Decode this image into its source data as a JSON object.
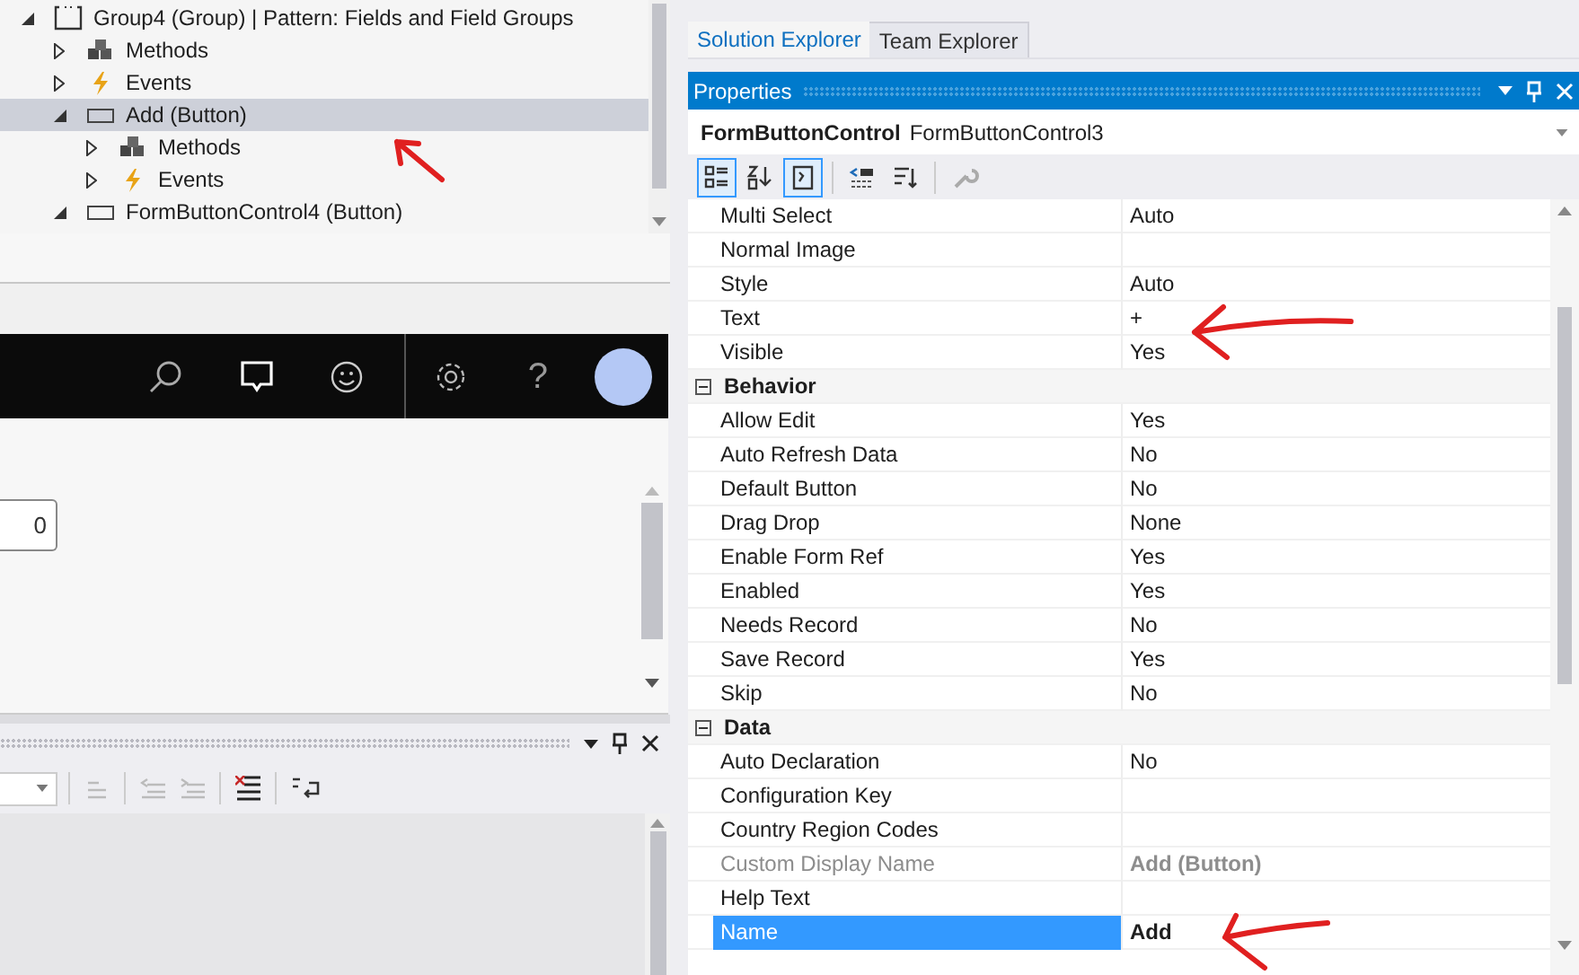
{
  "tree": [
    {
      "label": "Group4 (Group) | Pattern: Fields and Field Groups",
      "kind": "group",
      "expanded": true,
      "selected": false,
      "children": [
        {
          "label": "Methods",
          "kind": "methods",
          "expanded": false,
          "selected": false
        },
        {
          "label": "Events",
          "kind": "events",
          "expanded": false,
          "selected": false
        },
        {
          "label": "Add (Button)",
          "kind": "button",
          "expanded": true,
          "selected": true,
          "children": [
            {
              "label": "Methods",
              "kind": "methods",
              "expanded": false,
              "selected": false
            },
            {
              "label": "Events",
              "kind": "events",
              "expanded": false,
              "selected": false
            }
          ]
        },
        {
          "label": "FormButtonControl4 (Button)",
          "kind": "button",
          "expanded": true,
          "selected": false
        }
      ]
    }
  ],
  "help_button": {
    "label": "?"
  },
  "form_field": {
    "value": "0"
  },
  "tabs": [
    {
      "label": "Solution Explorer",
      "selected": true
    },
    {
      "label": "Team Explorer",
      "selected": false
    }
  ],
  "properties": {
    "title": "Properties",
    "object_type": "FormButtonControl",
    "object_name": "FormButtonControl3",
    "toolbar": [
      {
        "kind": "categorized",
        "selected": true
      },
      {
        "kind": "alphabetical",
        "selected": false
      },
      {
        "kind": "properties",
        "selected": true
      },
      {
        "kind": "events",
        "selected": false
      },
      {
        "kind": "sort",
        "selected": false
      },
      {
        "kind": "pages",
        "selected": false
      }
    ],
    "rows": [
      {
        "kind": "property",
        "name": "Multi Select",
        "value": "Auto",
        "disabled": false,
        "selected": false,
        "non_default": false
      },
      {
        "kind": "property",
        "name": "Normal Image",
        "disabled": false,
        "selected": false
      },
      {
        "kind": "property",
        "name": "Style",
        "value": "Auto",
        "disabled": false,
        "selected": false,
        "non_default": false
      },
      {
        "kind": "property",
        "name": "Text",
        "value": "+",
        "disabled": false,
        "selected": false,
        "non_default": false
      },
      {
        "kind": "property",
        "name": "Visible",
        "value": "Yes",
        "disabled": false,
        "selected": false,
        "non_default": false
      },
      {
        "kind": "category",
        "name": "Behavior",
        "expanded": true
      },
      {
        "kind": "property",
        "name": "Allow Edit",
        "value": "Yes",
        "disabled": false,
        "selected": false,
        "non_default": false
      },
      {
        "kind": "property",
        "name": "Auto Refresh Data",
        "value": "No",
        "disabled": false,
        "selected": false,
        "non_default": false
      },
      {
        "kind": "property",
        "name": "Default Button",
        "value": "No",
        "disabled": false,
        "selected": false,
        "non_default": false
      },
      {
        "kind": "property",
        "name": "Drag Drop",
        "value": "None",
        "disabled": false,
        "selected": false,
        "non_default": false
      },
      {
        "kind": "property",
        "name": "Enable Form Ref",
        "value": "Yes",
        "disabled": false,
        "selected": false,
        "non_default": false
      },
      {
        "kind": "property",
        "name": "Enabled",
        "value": "Yes",
        "disabled": false,
        "selected": false,
        "non_default": false
      },
      {
        "kind": "property",
        "name": "Needs Record",
        "value": "No",
        "disabled": false,
        "selected": false,
        "non_default": false
      },
      {
        "kind": "property",
        "name": "Save Record",
        "value": "Yes",
        "disabled": false,
        "selected": false,
        "non_default": false
      },
      {
        "kind": "property",
        "name": "Skip",
        "value": "No",
        "disabled": false,
        "selected": false,
        "non_default": false
      },
      {
        "kind": "category",
        "name": "Data",
        "expanded": true
      },
      {
        "kind": "property",
        "name": "Auto Declaration",
        "value": "No",
        "disabled": false,
        "selected": false,
        "non_default": false
      },
      {
        "kind": "property",
        "name": "Configuration Key",
        "disabled": false,
        "selected": false
      },
      {
        "kind": "property",
        "name": "Country Region Codes",
        "disabled": false,
        "selected": false
      },
      {
        "kind": "property",
        "name": "Custom Display Name",
        "value": "Add (Button)",
        "disabled": true,
        "selected": false,
        "non_default": true
      },
      {
        "kind": "property",
        "name": "Help Text",
        "disabled": false,
        "selected": false
      },
      {
        "kind": "property",
        "name": "Name",
        "value": "Add",
        "disabled": false,
        "selected": true,
        "non_default": true
      }
    ]
  }
}
